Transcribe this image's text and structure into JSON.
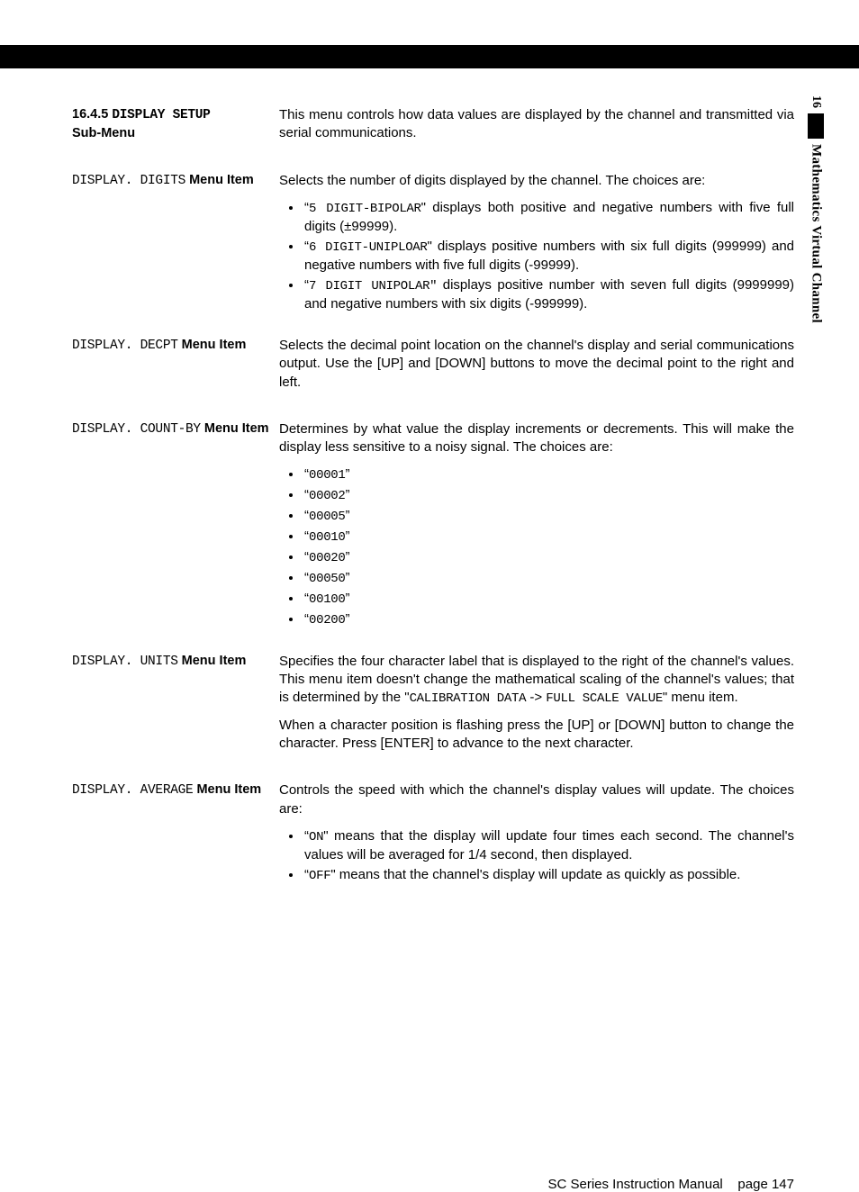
{
  "chapter": {
    "number": "16",
    "name": "Mathematics Virtual Channel"
  },
  "section_head": {
    "number": "16.4.5",
    "title_lcd": "DISPLAY SETUP",
    "title_tail": "Sub-Menu",
    "intro": "This menu controls how data values are displayed by the channel and transmitted via serial communications."
  },
  "items": {
    "digits": {
      "label_lcd": "DISPLAY. DIGITS",
      "label_tail": "Menu Item",
      "lead": "Selects the number of digits displayed by the channel. The choices are:",
      "b1_code": "5 DIGIT-BIPOLAR",
      "b1_tail": "\" displays both positive and negative numbers with five full digits (±99999).",
      "b2_code": "6 DIGIT-UNIPLOAR",
      "b2_tail": "\" displays positive numbers with six full digits (999999) and negative numbers with five full digits (-99999).",
      "b3_code": "7 DIGIT UNIPOLAR\"",
      "b3_tail": " displays positive number with seven full digits (9999999) and negative numbers with six digits (-999999)."
    },
    "decpt": {
      "label_lcd": "DISPLAY. DECPT",
      "label_tail": "Menu Item",
      "text": "Selects the decimal point location on the channel's display and serial communications output.  Use the [UP] and [DOWN] buttons to move the decimal point to the right and left."
    },
    "countby": {
      "label_lcd": "DISPLAY. COUNT-BY",
      "label_tail": "Menu Item",
      "lead": "Determines by what value the display increments or decrements.  This will make the display less sensitive to a noisy signal. The choices are:",
      "opts": [
        "00001",
        "00002",
        "00005",
        "00010",
        "00020",
        "00050",
        "00100",
        "00200"
      ]
    },
    "units": {
      "label_lcd": "DISPLAY. UNITS",
      "label_tail": "Menu Item",
      "p1_pre": "Specifies the four character label that is displayed to the right of the channel's values.  This menu item doesn't change the mathematical scaling of the channel's values; that is determined by the \"",
      "p1_code1": "CALIBRATION DATA",
      "p1_mid": " -> ",
      "p1_code2": "FULL SCALE VALUE",
      "p1_post": "\" menu item.",
      "p2": "When a character position is flashing press the [UP] or [DOWN] button to change the character.  Press [ENTER] to advance to the next character."
    },
    "average": {
      "label_lcd": "DISPLAY. AVERAGE",
      "label_tail": "Menu Item",
      "lead": "Controls the speed with which the channel's display values will update.  The choices are:",
      "b1_code": "ON",
      "b1_tail": "\" means that the display will update four times each second.  The channel's values will be averaged for 1/4 second, then displayed.",
      "b2_code": "OFF",
      "b2_tail": "\" means that the channel's display will update as quickly as possible."
    }
  },
  "footer": {
    "manual": "SC Series Instruction Manual",
    "page_label": "page 147"
  }
}
